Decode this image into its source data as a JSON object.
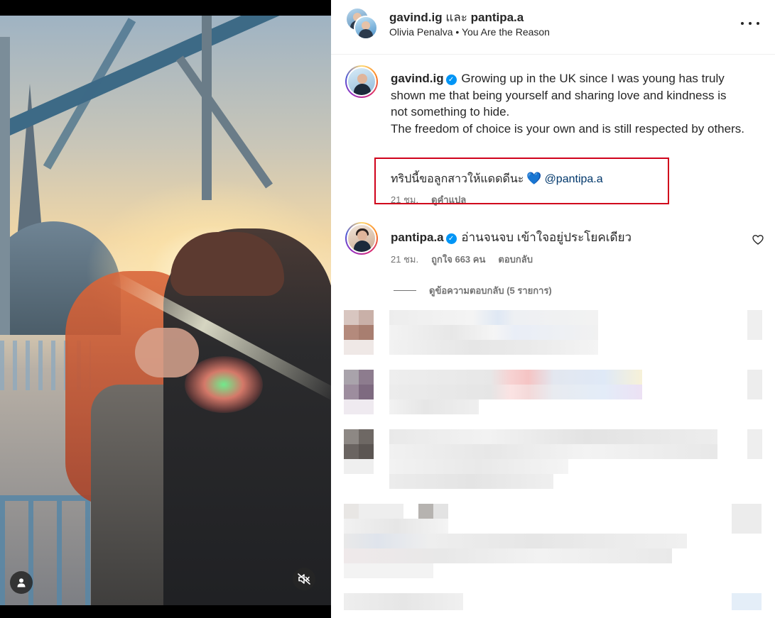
{
  "header": {
    "user1": "gavind.ig",
    "conjunction": "และ",
    "user2": "pantipa.a",
    "song_artist": "Olivia Penalva",
    "separator": "•",
    "song_title": "You Are the Reason"
  },
  "caption": {
    "username": "gavind.ig",
    "text": "Growing up in the UK since I was young has truly shown me that being yourself and sharing love and kindness is not something to hide.",
    "text2": "The freedom of choice is your own and is still respected by others.",
    "thai_line": "ทริปนี้ขอลูกสาวให้แดดดีนะ",
    "heart": "💙",
    "mention": "@pantipa.a",
    "time": "21 ชม.",
    "translate_label": "ดูคำแปล"
  },
  "comment": {
    "username": "pantipa.a",
    "text": "อ่านจนจบ เข้าใจอยู่ประโยคเดียว",
    "time": "21 ชม.",
    "likes_label": "ถูกใจ 663 คน",
    "reply_label": "ตอบกลับ",
    "view_replies_label": "ดูข้อความตอบกลับ (5 รายการ)"
  },
  "icons": {
    "verified": "verified-badge",
    "more": "more-options",
    "like": "heart-outline",
    "user_tag": "person",
    "mute": "speaker-muted"
  },
  "colors": {
    "verified_blue": "#0095f6",
    "mention_blue": "#00376b",
    "highlight_red": "#d0021b",
    "meta_gray": "#737373"
  }
}
